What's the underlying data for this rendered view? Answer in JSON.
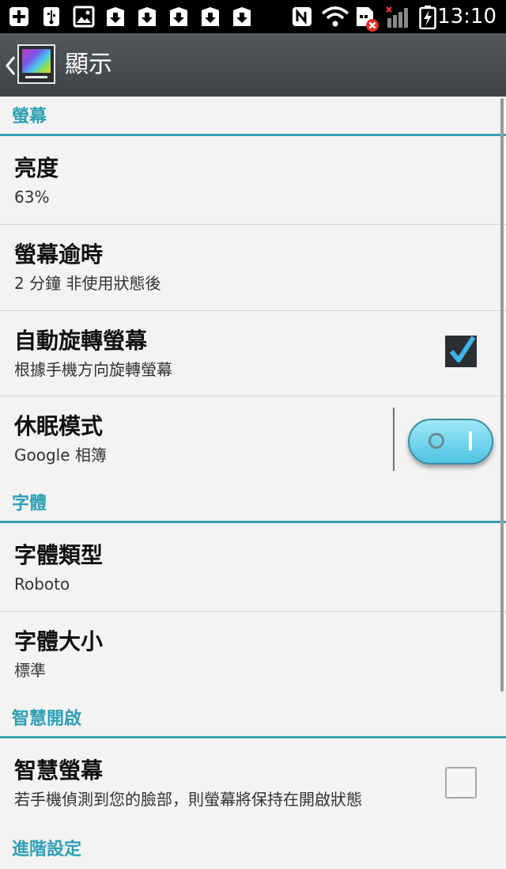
{
  "status_bar": {
    "time": "13:10",
    "icons": [
      "add-icon",
      "usb-icon",
      "image-icon",
      "download-icon",
      "download-icon",
      "download-icon",
      "download-icon",
      "download-icon",
      "nfc-icon",
      "wifi-icon",
      "sim-error-icon",
      "signal-icon",
      "battery-charging-icon"
    ]
  },
  "action_bar": {
    "title": "顯示",
    "icon": "display-settings-icon"
  },
  "sections": {
    "screen": {
      "header": "螢幕"
    },
    "font": {
      "header": "字體"
    },
    "smart_on": {
      "header": "智慧開啟"
    },
    "advanced": {
      "header": "進階設定"
    }
  },
  "rows": {
    "brightness": {
      "title": "亮度",
      "summary": "63%"
    },
    "screen_timeout": {
      "title": "螢幕逾時",
      "summary": "2 分鐘 非使用狀態後"
    },
    "auto_rotate": {
      "title": "自動旋轉螢幕",
      "summary": "根據手機方向旋轉螢幕",
      "checked": true
    },
    "daydream": {
      "title": "休眠模式",
      "summary": "Google 相簿",
      "enabled": true
    },
    "font_type": {
      "title": "字體類型",
      "summary": "Roboto"
    },
    "font_size": {
      "title": "字體大小",
      "summary": "標準"
    },
    "smart_screen": {
      "title": "智慧螢幕",
      "summary": "若手機偵測到您的臉部，則螢幕將保持在開啟狀態",
      "checked": false
    }
  },
  "colors": {
    "accent": "#2f9fb4",
    "section_rule": "#3aa0b0",
    "action_bar": "#484c50",
    "toggle_on": "#6fd3ea"
  }
}
